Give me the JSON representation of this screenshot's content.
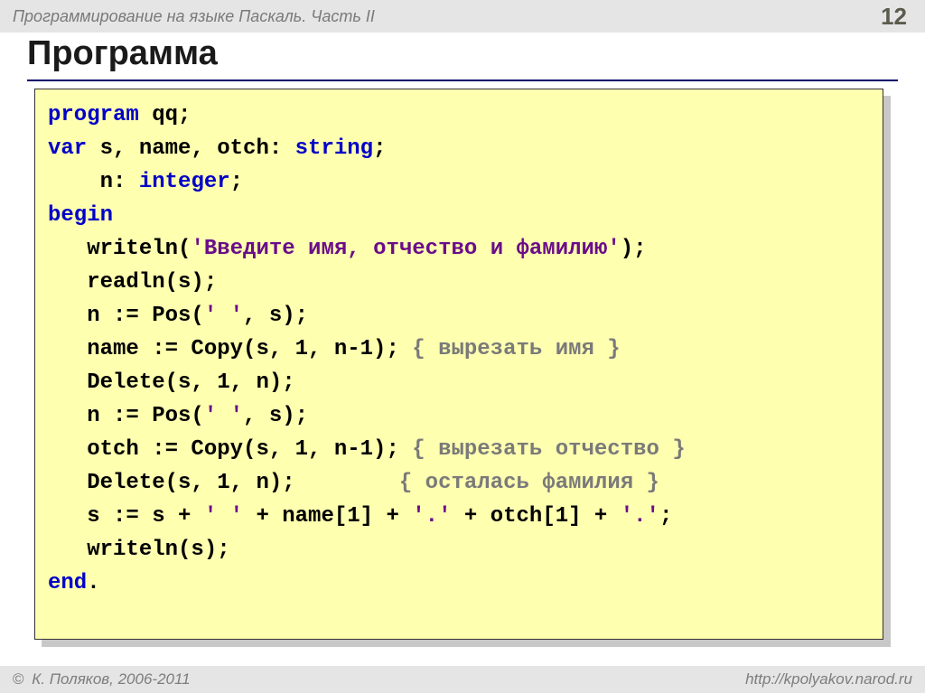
{
  "header": {
    "title": "Программирование на языке Паскаль. Часть II",
    "page_number": "12"
  },
  "main": {
    "heading": "Программа"
  },
  "code": {
    "l1_kw": "program",
    "l1_rest": " qq;",
    "l2_kw": "var",
    "l2_rest": " s, name, otch: ",
    "l2_type": "string",
    "l2_end": ";",
    "l3_pre": "    n: ",
    "l3_type": "integer",
    "l3_end": ";",
    "l4_kw": "begin",
    "l5_pre": "   writeln(",
    "l5_str": "'Введите имя, отчество и фамилию'",
    "l5_end": ");",
    "l6": "   readln(s);",
    "l7_pre": "   n := Pos(",
    "l7_str": "' '",
    "l7_end": ", s);",
    "l8_pre": "   name := Copy(s, 1, n-1); ",
    "l8_cmt": "{ вырезать имя }",
    "l9": "   Delete(s, 1, n);",
    "l10_pre": "   n := Pos(",
    "l10_str": "' '",
    "l10_end": ", s);",
    "l11_pre": "   otch := Copy(s, 1, n-1); ",
    "l11_cmt": "{ вырезать отчество }",
    "l12_pre": "   Delete(s, 1, n);        ",
    "l12_cmt": "{ осталась фамилия }",
    "l13_a": "   s := s + ",
    "l13_s1": "' '",
    "l13_b": " + name[1] + ",
    "l13_s2": "'.'",
    "l13_c": " + otch[1] + ",
    "l13_s3": "'.'",
    "l13_d": ";",
    "l14": "   writeln(s);",
    "l15_kw": "end",
    "l15_end": "."
  },
  "footer": {
    "copyright": " К. Поляков, 2006-2011",
    "url": "http://kpolyakov.narod.ru"
  }
}
